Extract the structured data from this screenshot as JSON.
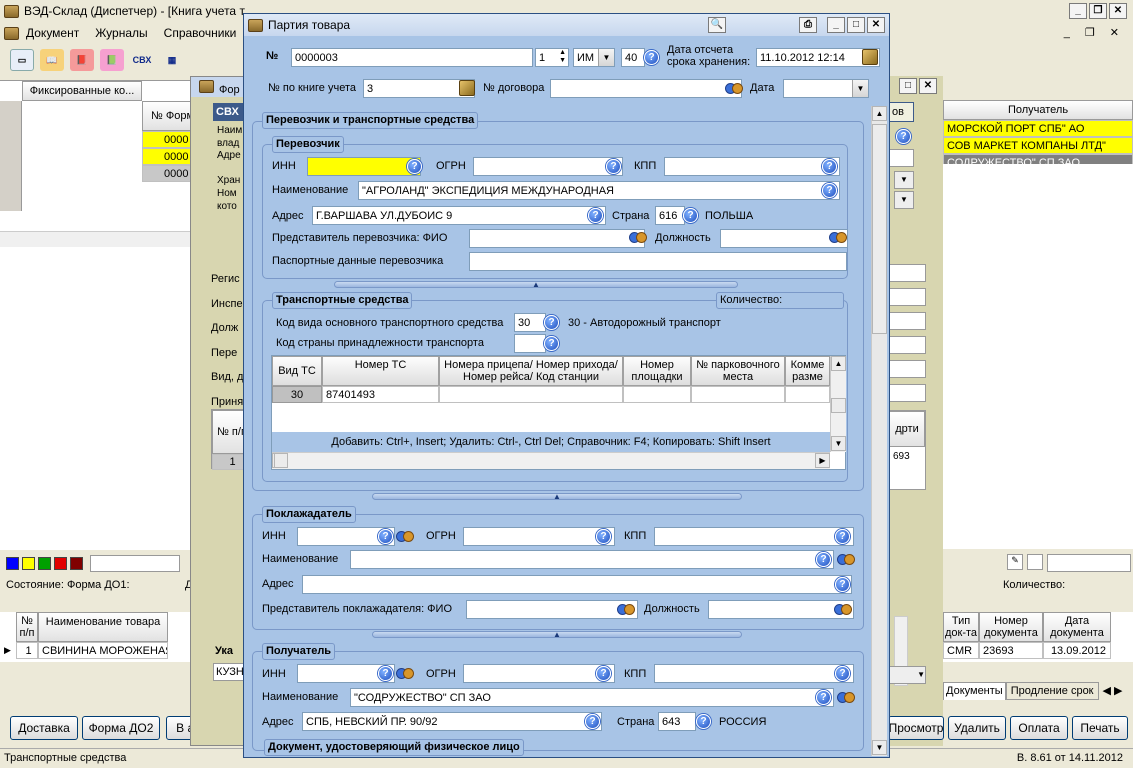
{
  "app": {
    "title": "ВЭД-Склад (Диспетчер) - [Книга учета т",
    "menu": [
      "Документ",
      "Журналы",
      "Справочники"
    ],
    "toolbar_svx": "СВХ",
    "status_left": "Транспортные средства",
    "version": "В. 8.61 от 14.11.2012"
  },
  "bg": {
    "fixed_col": "Фиксированные ко...",
    "form_col": "№ Форм",
    "rows": [
      "0000",
      "0000",
      "0000"
    ],
    "recipient_header": "Получатель",
    "recipients": [
      "МОРСКОЙ ПОРТ СПБ\" АО",
      "СОВ МАРКЕТ КОМПАНЫ ЛТД\"",
      "СОДРУЖЕСТВО\" СП ЗАО"
    ],
    "state_label": "Состояние:",
    "state_value": "Форма ДО1:",
    "d_label": "Д",
    "qty_label": "Количество:",
    "goods_headers": [
      "№ п/п",
      "Наименование товара"
    ],
    "goods_row": {
      "n": "1",
      "name": "СВИНИНА МОРОЖЕНАЯ"
    },
    "doc_headers": [
      "Тип док-та",
      "Номер документа",
      "Дата документа"
    ],
    "doc_row": [
      "CMR",
      "23693",
      "13.09.2012"
    ],
    "tabs": [
      "Документы",
      "Продление срок"
    ],
    "buttons_left": [
      "Доставка",
      "Форма ДО2",
      "В архив"
    ],
    "buttons_right": [
      "Просмотр",
      "Удалить",
      "Оплата",
      "Печать"
    ],
    "form_title": "Фор",
    "svx": "СВХ",
    "left_labels": [
      "Наим",
      "влад",
      "Адре",
      "Хран",
      "Ном",
      "кото"
    ],
    "side_labels": [
      "Регис",
      "Инспе",
      "Долж",
      "Пере",
      "Вид, д",
      "Приня"
    ],
    "np_header": "№ п/п",
    "np_row": "1",
    "uka": "Ука",
    "kuz": "КУЗН",
    "num_3693": "693",
    "col_d": "д",
    "col_rt": "рти",
    "btn_ov": "ов"
  },
  "dlg": {
    "title": "Партия товара",
    "num_label": "№",
    "num_value": "0000003",
    "spin_value": "1",
    "unit": "ИМ",
    "unit_code": "40",
    "date_label": "Дата отсчета срока хранения:",
    "date_value": "11.10.2012 12:14",
    "book_label": "№ по книге учета",
    "book_value": "3",
    "contract_label": "№ договора",
    "contract_value": "",
    "date2_label": "Дата",
    "date2_value": "",
    "carrier_section": "Перевозчик и транспортные средства",
    "carrier": {
      "title": "Перевозчик",
      "inn_label": "ИНН",
      "inn": "",
      "ogrn_label": "ОГРН",
      "ogrn": "",
      "kpp_label": "КПП",
      "kpp": "",
      "name_label": "Наименование",
      "name": "\"АГРОЛАНД\" ЭКСПЕДИЦИЯ МЕЖДУНАРОДНАЯ",
      "addr_label": "Адрес",
      "addr": "Г.ВАРШАВА УЛ.ДУБОИС 9",
      "country_label": "Страна",
      "country_code": "616",
      "country_name": "ПОЛЬША",
      "rep_label": "Представитель перевозчика:  ФИО",
      "rep": "",
      "pos_label": "Должность",
      "pos": "",
      "passport_label": "Паспортные данные перевозчика",
      "passport": ""
    },
    "transport": {
      "title": "Транспортные средства",
      "qty_label": "Количество:",
      "kind_label": "Код вида основного транспортного средства",
      "kind_code": "30",
      "kind_name": "30 - Автодорожный транспорт",
      "country_label": "Код страны принадлежности транспорта",
      "country": "",
      "headers": [
        "Вид ТС",
        "Номер ТС",
        "Номера прицепа/ Номер прихода/ Номер рейса/ Код станции",
        "Номер площадки",
        "№ парковочного места",
        "Комме разме"
      ],
      "row": {
        "kind": "30",
        "number": "87401493"
      },
      "hint": "Добавить: Ctrl+, Insert; Удалить: Ctrl-, Ctrl Del; Справочник: F4; Копировать: Shift Insert"
    },
    "depositor": {
      "title": "Поклажадатель",
      "inn_label": "ИНН",
      "ogrn_label": "ОГРН",
      "kpp_label": "КПП",
      "name_label": "Наименование",
      "addr_label": "Адрес",
      "rep_label": "Представитель поклажадателя:  ФИО",
      "pos_label": "Должность"
    },
    "recipient": {
      "title": "Получатель",
      "inn_label": "ИНН",
      "ogrn_label": "ОГРН",
      "kpp_label": "КПП",
      "name_label": "Наименование",
      "name": "\"СОДРУЖЕСТВО\" СП ЗАО",
      "addr_label": "Адрес",
      "addr": "СПБ, НЕВСКИЙ ПР. 90/92",
      "country_label": "Страна",
      "country_code": "643",
      "country_name": "РОССИЯ"
    },
    "doc_section": "Документ, удостоверяющий физическое лицо"
  },
  "colors": {
    "blue": "#a8c4e6",
    "yellow": "#ffff00",
    "swatches": [
      "#0000ff",
      "#ffff00",
      "#00a000",
      "#e00000",
      "#800000"
    ]
  }
}
